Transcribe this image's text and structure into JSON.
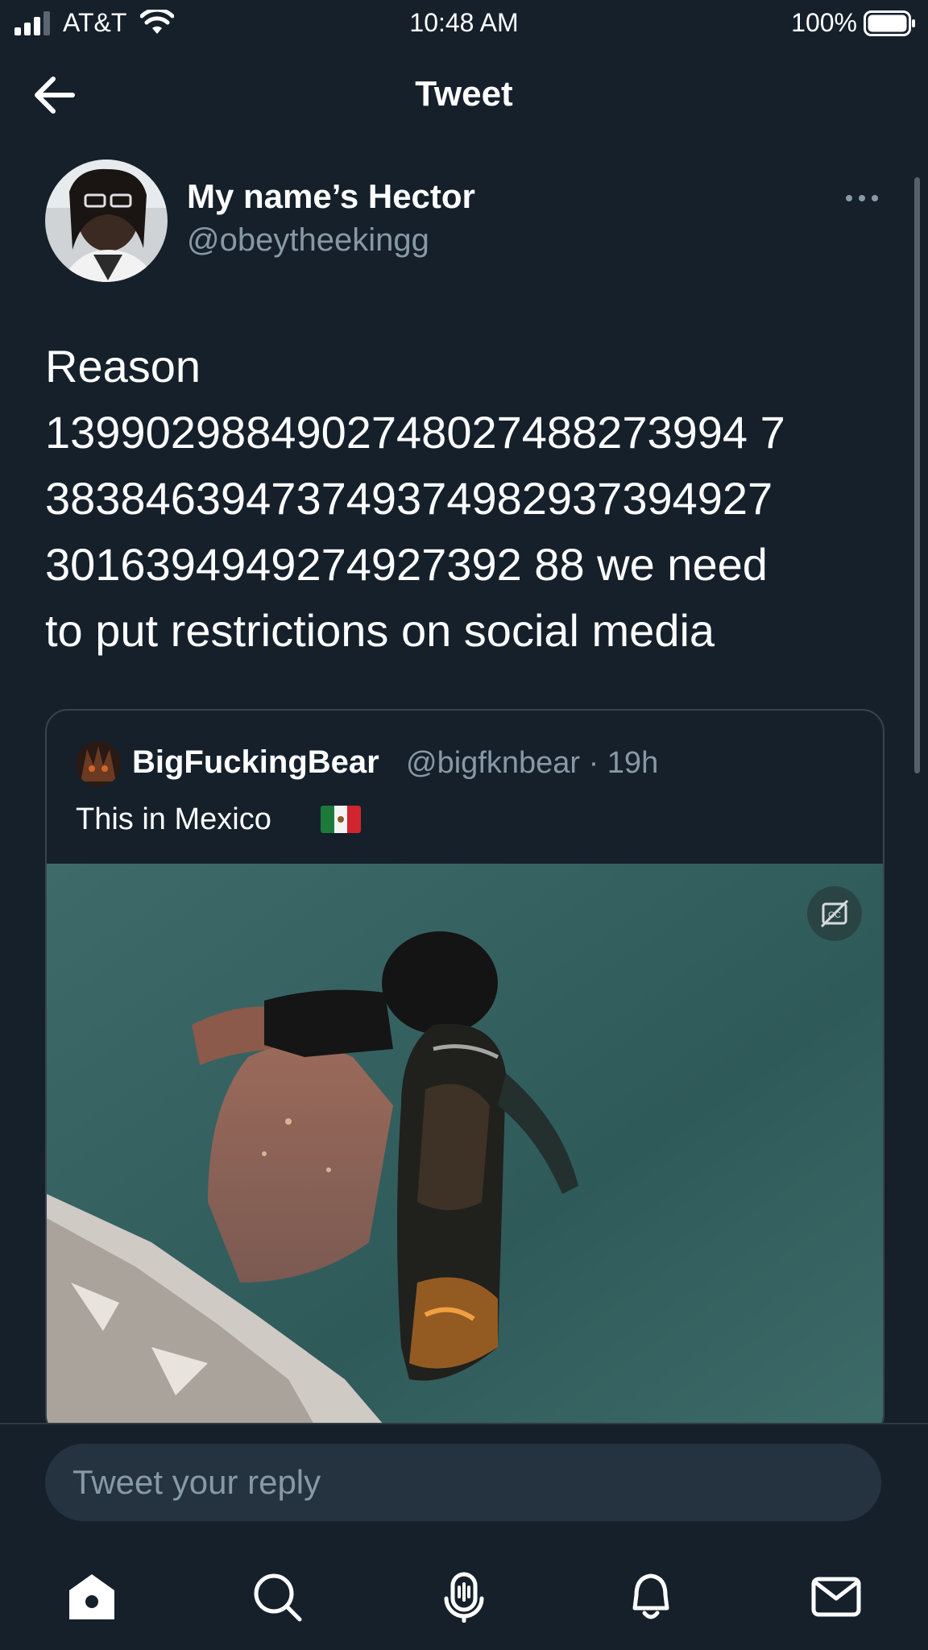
{
  "status_bar": {
    "carrier": "AT&T",
    "time": "10:48 AM",
    "battery": "100%"
  },
  "header": {
    "title": "Tweet",
    "back_icon": "arrow-left-icon"
  },
  "tweet": {
    "author_name": "My name’s Hector",
    "author_handle": "@obeytheekingg",
    "text": "Reason\n1399029884902748027488273994 7\n38384639473749374982937394927\n3016394949274927392 88 we need\nto put restrictions on social media",
    "more_icon": "more-options-icon"
  },
  "quote": {
    "author_name": "BigFuckingBear",
    "author_handle": "@bigfknbear · 19h",
    "text": "This in Mexico",
    "flag_icon": "mexico-flag-icon",
    "cc_icon": "closed-captions-icon"
  },
  "reply": {
    "placeholder": "Tweet your reply"
  },
  "tabs": [
    {
      "name": "home-icon"
    },
    {
      "name": "search-icon"
    },
    {
      "name": "spaces-icon"
    },
    {
      "name": "notifications-icon"
    },
    {
      "name": "messages-icon"
    }
  ],
  "colors": {
    "background": "#15202b",
    "secondary_text": "#8899a6",
    "border": "#38444d",
    "input_background": "#253341"
  }
}
